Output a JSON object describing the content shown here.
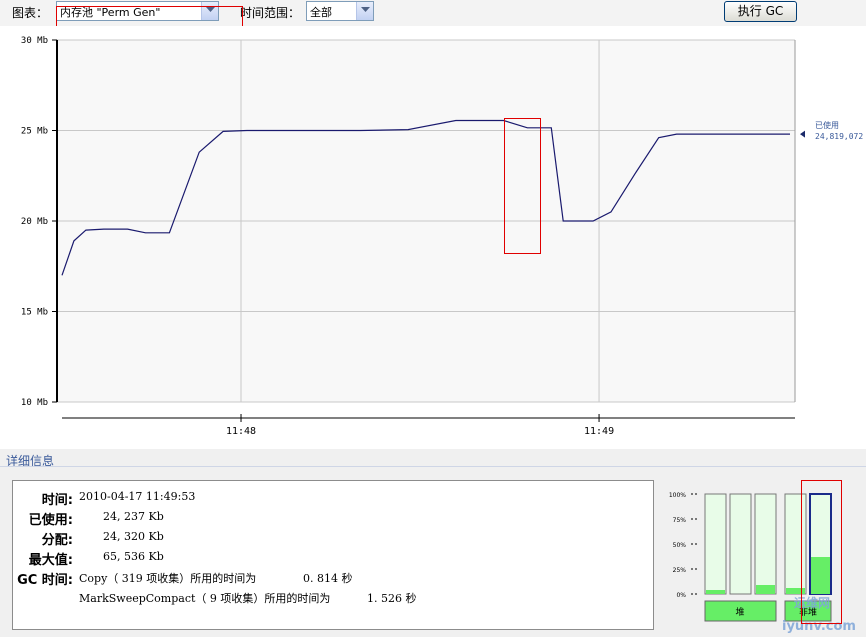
{
  "toolbar": {
    "chart_label": "图表：",
    "chart_value": "内存池 \"Perm Gen\"",
    "range_label": "时间范围：",
    "range_value": "全部",
    "gc_button": "执行 GC"
  },
  "chart_data": {
    "type": "line",
    "ylabel": "",
    "yticks": [
      "30 Mb",
      "25 Mb",
      "20 Mb",
      "15 Mb",
      "10 Mb"
    ],
    "ylim": [
      10,
      30
    ],
    "xticks": [
      "11:48",
      "11:49"
    ],
    "grid": true,
    "legend": {
      "title": "已使用",
      "value": "24,819,072",
      "placement": "right"
    },
    "series": [
      {
        "name": "已使用",
        "color": "#1a1a6e",
        "x": [
          "11:47:30",
          "11:47:32",
          "11:47:34",
          "11:47:37",
          "11:47:41",
          "11:47:44",
          "11:47:48",
          "11:47:53",
          "11:47:57",
          "11:48:01",
          "11:48:20",
          "11:48:28",
          "11:48:36",
          "11:48:44",
          "11:48:48",
          "11:48:52",
          "11:48:54",
          "11:48:59",
          "11:49:02",
          "11:49:06",
          "11:49:10",
          "11:49:13",
          "11:49:32"
        ],
        "values": [
          17.0,
          18.9,
          19.5,
          19.55,
          19.55,
          19.35,
          19.35,
          23.8,
          24.95,
          25.0,
          25.0,
          25.05,
          25.55,
          25.55,
          25.15,
          25.15,
          20.0,
          20.0,
          20.5,
          22.6,
          24.6,
          24.8,
          24.8
        ]
      }
    ]
  },
  "details": {
    "title": "详细信息",
    "time_label": "时间:",
    "time_value": "2010-04-17 11:49:53",
    "used_label": "已使用:",
    "used_value": "24, 237 Kb",
    "alloc_label": "分配:",
    "alloc_value": "24, 320 Kb",
    "max_label": "最大值:",
    "max_value": "65, 536 Kb",
    "gc_label": "GC 时间:",
    "gc1_text": "Copy（ 319 项收集）所用的时间为",
    "gc1_value": "0. 814 秒",
    "gc2_text": "MarkSweepCompact（ 9 项收集）所用的时间为",
    "gc2_value": "1. 526 秒"
  },
  "pools": {
    "ticks": [
      "100%",
      "75%",
      "50%",
      "25%",
      "0%"
    ],
    "bars": [
      {
        "fill": 0.04
      },
      {
        "fill": 0.0
      },
      {
        "fill": 0.09
      },
      {
        "fill": 0.06
      },
      {
        "fill": 0.37
      }
    ],
    "heap_label": "堆",
    "nonheap_label": "非堆"
  },
  "watermark": "运维网 iyunv.com",
  "colors": {
    "line": "#1a1a6e",
    "grid": "#c8c8c8",
    "pool_empty": "#e8fce8",
    "pool_fill": "#66ee66",
    "pool_selected": "#1a2a8a"
  }
}
